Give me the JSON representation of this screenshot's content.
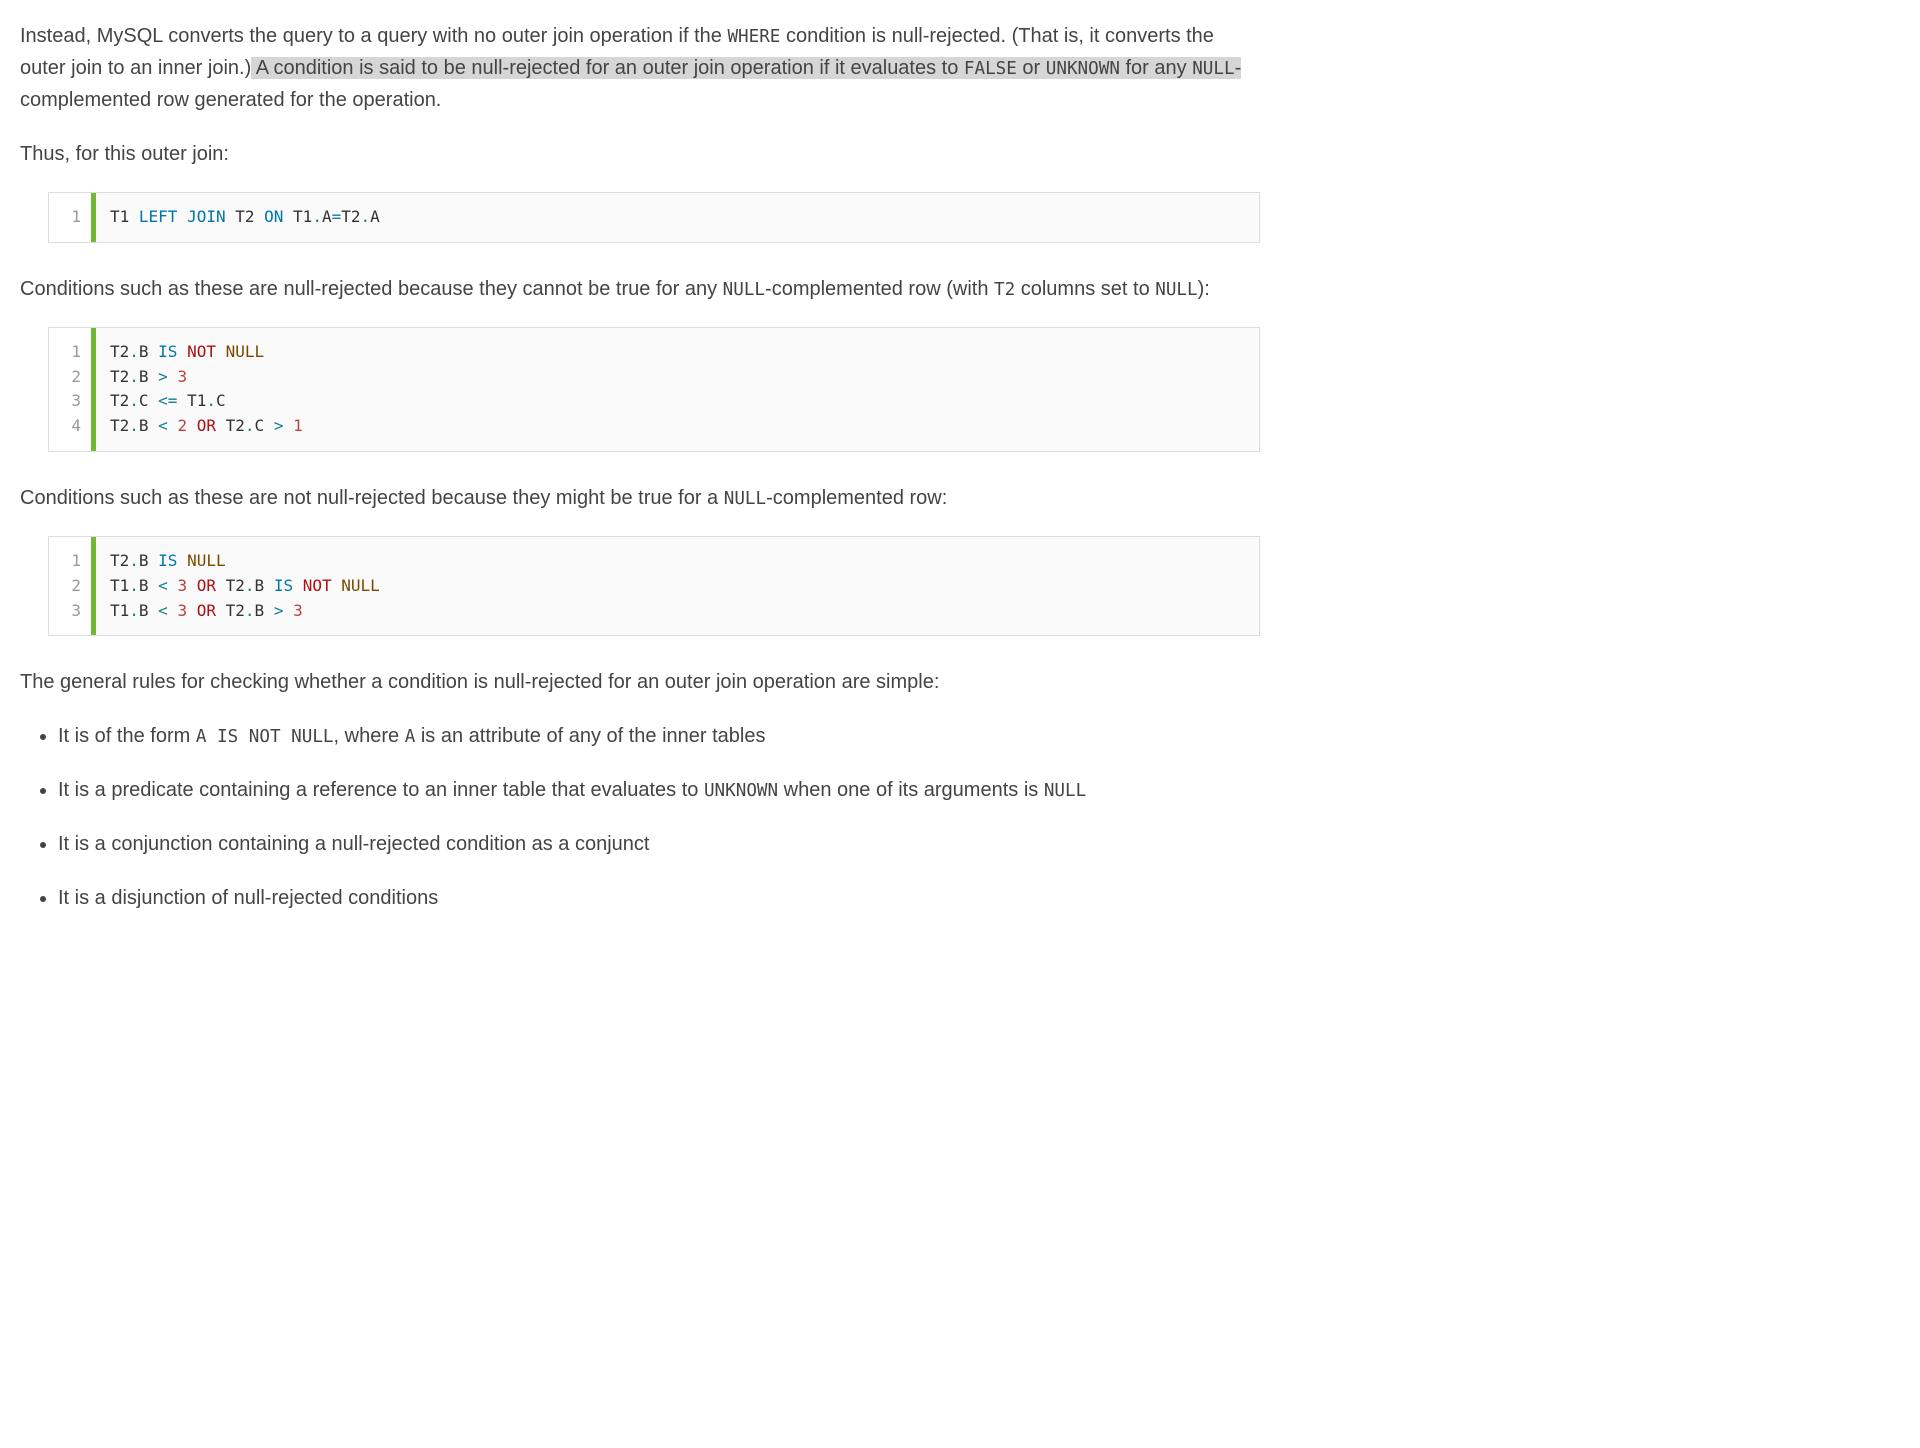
{
  "para1": {
    "t1": "Instead, MySQL converts the query to a query with no outer join operation if the ",
    "c1": "WHERE",
    "t2": " condition is null-rejected. (That is, it converts the outer join to an inner join.)",
    "h1": " A condition is said to be null-rejected for an outer join operation if it evaluates to ",
    "hc1": "FALSE",
    "h2": " or ",
    "hc2": "UNKNOWN",
    "h3": " for any ",
    "hc3": "NULL",
    "h4": "-",
    "t3": "complemented row generated for the operation."
  },
  "para2": "Thus, for this outer join:",
  "code1": {
    "lines": [
      "1"
    ],
    "tokens": [
      [
        {
          "t": "T1 ",
          "c": ""
        },
        {
          "t": "LEFT",
          "c": "kw-blue"
        },
        {
          "t": " ",
          "c": ""
        },
        {
          "t": "JOIN",
          "c": "kw-blue"
        },
        {
          "t": " T2 ",
          "c": ""
        },
        {
          "t": "ON",
          "c": "kw-blue"
        },
        {
          "t": " T1",
          "c": ""
        },
        {
          "t": ".",
          "c": "kw-teal"
        },
        {
          "t": "A",
          "c": ""
        },
        {
          "t": "=",
          "c": "kw-teal"
        },
        {
          "t": "T2",
          "c": ""
        },
        {
          "t": ".",
          "c": "kw-teal"
        },
        {
          "t": "A",
          "c": ""
        }
      ]
    ]
  },
  "para3": {
    "t1": "Conditions such as these are null-rejected because they cannot be true for any ",
    "c1": "NULL",
    "t2": "-complemented row (with ",
    "c2": "T2",
    "t3": " columns set to ",
    "c3": "NULL",
    "t4": "):"
  },
  "code2": {
    "lines": [
      "1",
      "2",
      "3",
      "4"
    ],
    "tokens": [
      [
        {
          "t": "T2",
          "c": ""
        },
        {
          "t": ".",
          "c": "kw-teal"
        },
        {
          "t": "B ",
          "c": ""
        },
        {
          "t": "IS",
          "c": "kw-blue"
        },
        {
          "t": " ",
          "c": ""
        },
        {
          "t": "NOT",
          "c": "kw-red"
        },
        {
          "t": " ",
          "c": ""
        },
        {
          "t": "NULL",
          "c": "kw-brown"
        }
      ],
      [
        {
          "t": "T2",
          "c": ""
        },
        {
          "t": ".",
          "c": "kw-teal"
        },
        {
          "t": "B ",
          "c": ""
        },
        {
          "t": ">",
          "c": "kw-teal"
        },
        {
          "t": " ",
          "c": ""
        },
        {
          "t": "3",
          "c": "num"
        }
      ],
      [
        {
          "t": "T2",
          "c": ""
        },
        {
          "t": ".",
          "c": "kw-teal"
        },
        {
          "t": "C ",
          "c": ""
        },
        {
          "t": "<=",
          "c": "kw-teal"
        },
        {
          "t": " T1",
          "c": ""
        },
        {
          "t": ".",
          "c": "kw-teal"
        },
        {
          "t": "C",
          "c": ""
        }
      ],
      [
        {
          "t": "T2",
          "c": ""
        },
        {
          "t": ".",
          "c": "kw-teal"
        },
        {
          "t": "B ",
          "c": ""
        },
        {
          "t": "<",
          "c": "kw-teal"
        },
        {
          "t": " ",
          "c": ""
        },
        {
          "t": "2",
          "c": "num"
        },
        {
          "t": " ",
          "c": ""
        },
        {
          "t": "OR",
          "c": "kw-red"
        },
        {
          "t": " T2",
          "c": ""
        },
        {
          "t": ".",
          "c": "kw-teal"
        },
        {
          "t": "C ",
          "c": ""
        },
        {
          "t": ">",
          "c": "kw-teal"
        },
        {
          "t": " ",
          "c": ""
        },
        {
          "t": "1",
          "c": "num"
        }
      ]
    ]
  },
  "para4": {
    "t1": "Conditions such as these are not null-rejected because they might be true for a ",
    "c1": "NULL",
    "t2": "-complemented row:"
  },
  "code3": {
    "lines": [
      "1",
      "2",
      "3"
    ],
    "tokens": [
      [
        {
          "t": "T2",
          "c": ""
        },
        {
          "t": ".",
          "c": "kw-teal"
        },
        {
          "t": "B ",
          "c": ""
        },
        {
          "t": "IS",
          "c": "kw-blue"
        },
        {
          "t": " ",
          "c": ""
        },
        {
          "t": "NULL",
          "c": "kw-brown"
        }
      ],
      [
        {
          "t": "T1",
          "c": ""
        },
        {
          "t": ".",
          "c": "kw-teal"
        },
        {
          "t": "B ",
          "c": ""
        },
        {
          "t": "<",
          "c": "kw-teal"
        },
        {
          "t": " ",
          "c": ""
        },
        {
          "t": "3",
          "c": "num"
        },
        {
          "t": " ",
          "c": ""
        },
        {
          "t": "OR",
          "c": "kw-red"
        },
        {
          "t": " T2",
          "c": ""
        },
        {
          "t": ".",
          "c": "kw-teal"
        },
        {
          "t": "B ",
          "c": ""
        },
        {
          "t": "IS",
          "c": "kw-blue"
        },
        {
          "t": " ",
          "c": ""
        },
        {
          "t": "NOT",
          "c": "kw-red"
        },
        {
          "t": " ",
          "c": ""
        },
        {
          "t": "NULL",
          "c": "kw-brown"
        }
      ],
      [
        {
          "t": "T1",
          "c": ""
        },
        {
          "t": ".",
          "c": "kw-teal"
        },
        {
          "t": "B ",
          "c": ""
        },
        {
          "t": "<",
          "c": "kw-teal"
        },
        {
          "t": " ",
          "c": ""
        },
        {
          "t": "3",
          "c": "num"
        },
        {
          "t": " ",
          "c": ""
        },
        {
          "t": "OR",
          "c": "kw-red"
        },
        {
          "t": " T2",
          "c": ""
        },
        {
          "t": ".",
          "c": "kw-teal"
        },
        {
          "t": "B ",
          "c": ""
        },
        {
          "t": ">",
          "c": "kw-teal"
        },
        {
          "t": " ",
          "c": ""
        },
        {
          "t": "3",
          "c": "num"
        }
      ]
    ]
  },
  "para5": "The general rules for checking whether a condition is null-rejected for an outer join operation are simple:",
  "bullets": {
    "b1": {
      "t1": "It is of the form ",
      "c1": "A IS NOT NULL",
      "t2": ", where ",
      "c2": "A",
      "t3": " is an attribute of any of the inner tables"
    },
    "b2": {
      "t1": "It is a predicate containing a reference to an inner table that evaluates to ",
      "c1": "UNKNOWN",
      "t2": " when one of its arguments is ",
      "c2": "NULL"
    },
    "b3": "It is a conjunction containing a null-rejected condition as a conjunct",
    "b4": "It is a disjunction of null-rejected conditions"
  }
}
